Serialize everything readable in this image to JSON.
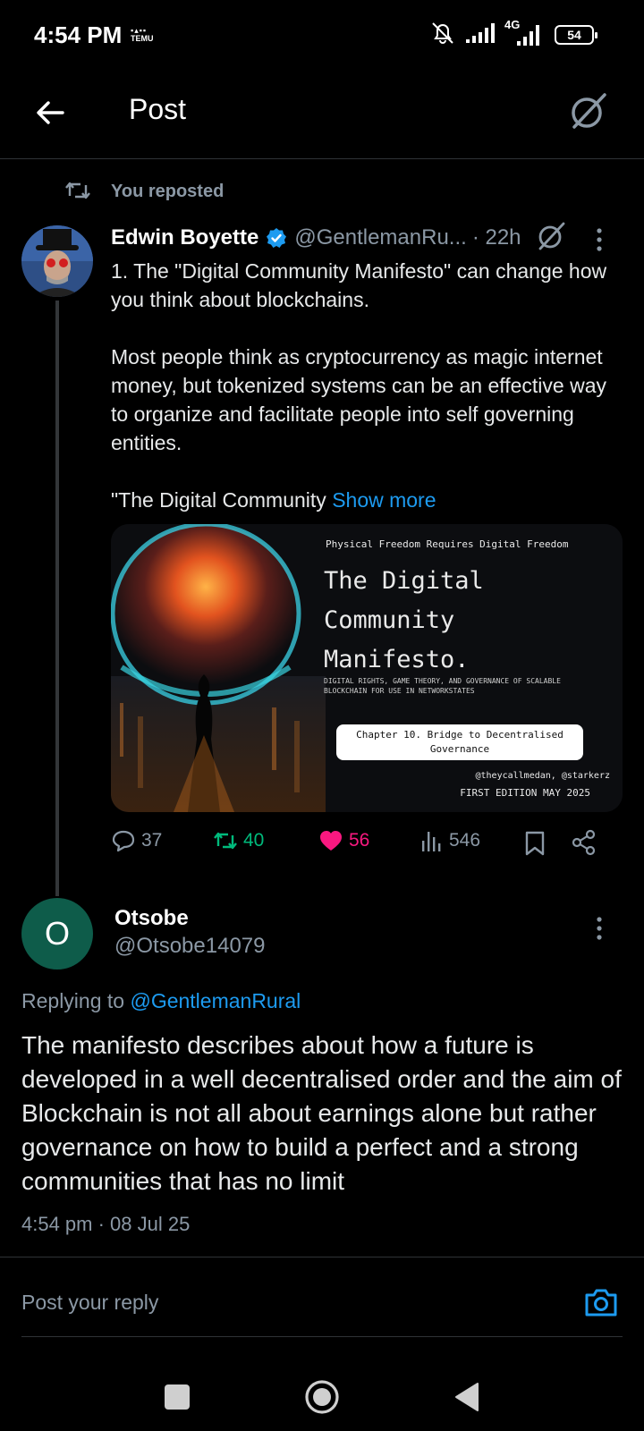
{
  "status_bar": {
    "time": "4:54 PM",
    "app_badge": "TEMU",
    "network": "4G",
    "battery": "54"
  },
  "header": {
    "title": "Post"
  },
  "repost": {
    "label": "You reposted"
  },
  "post": {
    "author_name": "Edwin Boyette",
    "handle": "@GentlemanRu...",
    "time": "· 22h",
    "paragraph1": "1. The \"Digital Community Manifesto\" can change how you think about blockchains.",
    "paragraph2": "Most people think as cryptocurrency as magic internet money, but tokenized systems can be an effective way to organize and facilitate people into self governing entities.",
    "paragraph3": "\"The Digital Community ",
    "show_more": "Show more",
    "media": {
      "top_line": "Physical Freedom Requires Digital Freedom",
      "title_line1": "The Digital",
      "title_line2": "Community",
      "title_line3": "Manifesto.",
      "subtitle_line1": "DIGITAL RIGHTS, GAME THEORY, AND GOVERNANCE OF SCALABLE",
      "subtitle_line2": "BLOCKCHAIN FOR USE IN NETWORKSTATES",
      "chip_line1": "Chapter 10. Bridge to Decentralised",
      "chip_line2": "Governance",
      "credit": "@theycallmedan, @starkerz",
      "edition": "FIRST EDITION MAY 2025"
    },
    "stats": {
      "replies": "37",
      "reposts": "40",
      "likes": "56",
      "views": "546"
    }
  },
  "reply": {
    "avatar_letter": "O",
    "author_name": "Otsobe",
    "handle": "@Otsobe14079",
    "replying_prefix": "Replying to ",
    "replying_to": "@GentlemanRural",
    "text": "The manifesto describes about how a future is developed in a well decentralised order and the aim of Blockchain is not all about earnings alone but rather governance on how to build a perfect and a strong communities that has no limit",
    "timestamp": "4:54 pm · 08 Jul 25"
  },
  "composer": {
    "placeholder": "Post your reply"
  },
  "colors": {
    "accent": "#1d9bf0",
    "repost": "#00ba7c",
    "like": "#f91880",
    "muted": "#8b98a5"
  }
}
